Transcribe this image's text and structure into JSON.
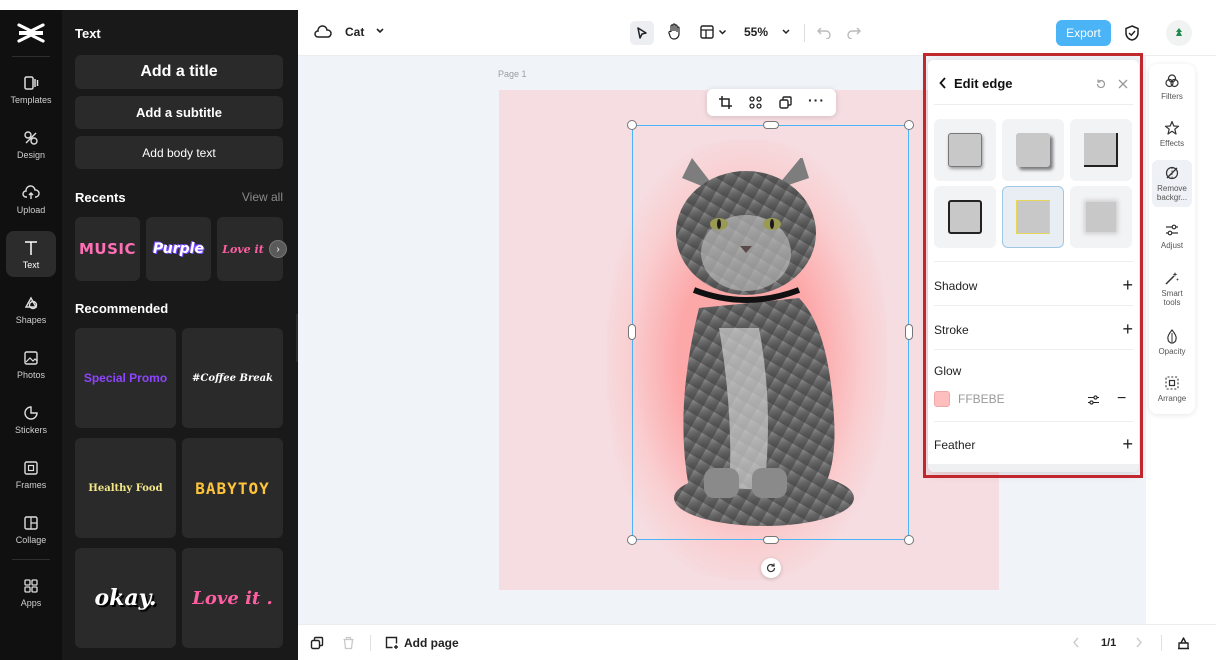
{
  "app": {
    "project_name": "Cat"
  },
  "rail": {
    "items": [
      {
        "key": "templates",
        "label": "Templates"
      },
      {
        "key": "design",
        "label": "Design"
      },
      {
        "key": "upload",
        "label": "Upload"
      },
      {
        "key": "text",
        "label": "Text",
        "active": true
      },
      {
        "key": "shapes",
        "label": "Shapes"
      },
      {
        "key": "photos",
        "label": "Photos"
      },
      {
        "key": "stickers",
        "label": "Stickers"
      },
      {
        "key": "frames",
        "label": "Frames"
      },
      {
        "key": "collage",
        "label": "Collage"
      },
      {
        "key": "apps",
        "label": "Apps"
      }
    ]
  },
  "text_panel": {
    "title": "Text",
    "add_title": "Add a title",
    "add_subtitle": "Add a subtitle",
    "add_body": "Add body text",
    "recents_label": "Recents",
    "view_all": "View all",
    "recents": [
      "MUSIC",
      "Purple",
      "Love it"
    ],
    "recommended_label": "Recommended",
    "recommended": [
      "Special Promo",
      "#Coffee Break",
      "Healthy Food",
      "BABYTOY",
      "okay.",
      "Love it ."
    ]
  },
  "toolbar": {
    "zoom": "55%",
    "export_label": "Export"
  },
  "canvas": {
    "page_label": "Page 1"
  },
  "right_tools": [
    {
      "key": "filters",
      "label": "Filters",
      "icon": "filters-icon"
    },
    {
      "key": "effects",
      "label": "Effects",
      "icon": "effects-icon"
    },
    {
      "key": "remove-bg",
      "label": "Remove backgr...",
      "icon": "remove-background-icon",
      "active": true
    },
    {
      "key": "adjust",
      "label": "Adjust",
      "icon": "adjust-icon"
    },
    {
      "key": "smart-tools",
      "label": "Smart tools",
      "icon": "smart-tools-icon"
    },
    {
      "key": "opacity",
      "label": "Opacity",
      "icon": "opacity-icon"
    },
    {
      "key": "arrange",
      "label": "Arrange",
      "icon": "arrange-icon"
    }
  ],
  "edge_panel": {
    "title": "Edit edge",
    "shadow_label": "Shadow",
    "stroke_label": "Stroke",
    "glow_label": "Glow",
    "glow_color_hex": "FFBEBE",
    "feather_label": "Feather"
  },
  "bottom": {
    "add_page": "Add page",
    "page_indicator": "1/1"
  },
  "colors": {
    "accent": "#4ab4f7",
    "glow": "#FFBEBE",
    "highlight": "#c0282d",
    "canvas_page": "#f5dde1"
  }
}
